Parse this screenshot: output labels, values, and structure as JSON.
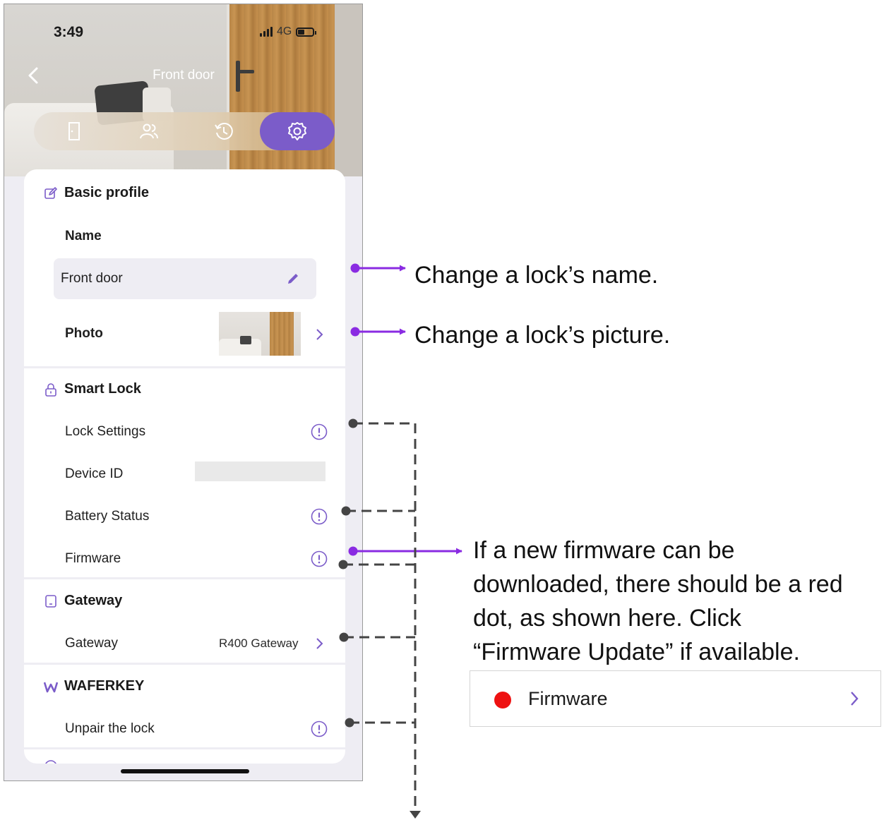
{
  "status_bar": {
    "time": "3:49",
    "network": "4G"
  },
  "header": {
    "title": "Front door"
  },
  "tabs": [
    {
      "icon": "door-icon"
    },
    {
      "icon": "users-icon"
    },
    {
      "icon": "history-icon"
    },
    {
      "icon": "gear-icon",
      "active": true
    }
  ],
  "basic_profile": {
    "heading": "Basic profile",
    "name_label": "Name",
    "name_value": "Front door",
    "photo_label": "Photo"
  },
  "smart_lock": {
    "heading": "Smart Lock",
    "rows": [
      "Lock Settings",
      "Device ID",
      "Battery Status",
      "Firmware"
    ]
  },
  "gateway": {
    "heading": "Gateway",
    "row_label": "Gateway",
    "row_value": "R400 Gateway"
  },
  "waferkey": {
    "heading": "WAFERKEY",
    "row_label": "Unpair the lock"
  },
  "annotations": {
    "name_note": "Change a lock’s name.",
    "photo_note": "Change a lock’s picture.",
    "firmware_note_lines": [
      "If a new firmware can be",
      "downloaded, there should be a red",
      "dot, as shown here. Click",
      "“Firmware Update” if available."
    ],
    "firmware_example_label": "Firmware"
  },
  "colors": {
    "accent_purple": "#7b5cc9",
    "arrow_purple": "#8a2be2",
    "red_dot": "#ee1111",
    "dashed_gray": "#444444"
  }
}
